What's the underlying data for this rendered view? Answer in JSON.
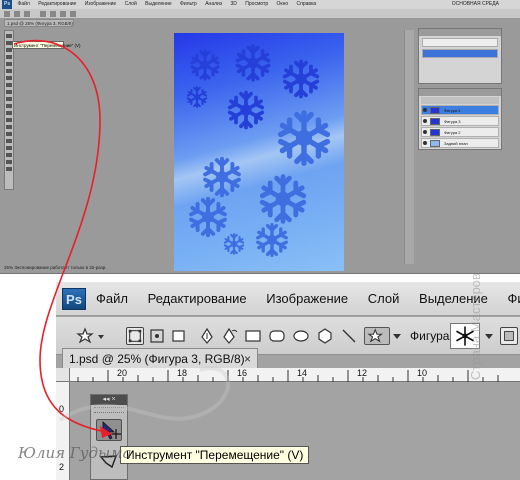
{
  "top_screenshot": {
    "menu": [
      "Файл",
      "Редактирование",
      "Изображение",
      "Слой",
      "Выделение",
      "Фильтр",
      "Анализ",
      "3D",
      "Просмотр",
      "Окно",
      "Справка"
    ],
    "menu_right": "ОСНОВНАЯ СРЕДА",
    "doc_tab": "1.psd @ 25% (Фигура 3, RGB/8)",
    "tooltip": "Инструмент \"Перемещение\" (V)",
    "status": "25%   Экспонирование работает только в 32-разр.",
    "layers_top_names": [
      "Слой",
      "Слой"
    ],
    "layers_main_names": [
      "Фигура 4",
      "Фигура 3",
      "Фигура 2",
      "Фигура 1",
      "Задний план"
    ]
  },
  "zoom": {
    "ps_logo": "Ps",
    "menu": [
      "Файл",
      "Редактирование",
      "Изображение",
      "Слой",
      "Выделение",
      "Фильтр"
    ],
    "shape_label": "Фигура:",
    "doc_tab": "1.psd @ 25% (Фигура 3, RGB/8)",
    "close": "×",
    "ruler_h": [
      "20",
      "18",
      "16",
      "14",
      "12",
      "10"
    ],
    "ruler_v": [
      "0",
      "2"
    ],
    "toolbox_header": "◂◂ ×",
    "tooltip": "Инструмент \"Перемещение\" (V)"
  },
  "credit": "Юлия Гудыма",
  "site_mark": "Страна Мастеров",
  "colors": {
    "arrow": "#e8202a",
    "canvas_dark": "#2538e8",
    "canvas_light": "#8ac0f6",
    "selected_layer": "#3d7fe0"
  }
}
